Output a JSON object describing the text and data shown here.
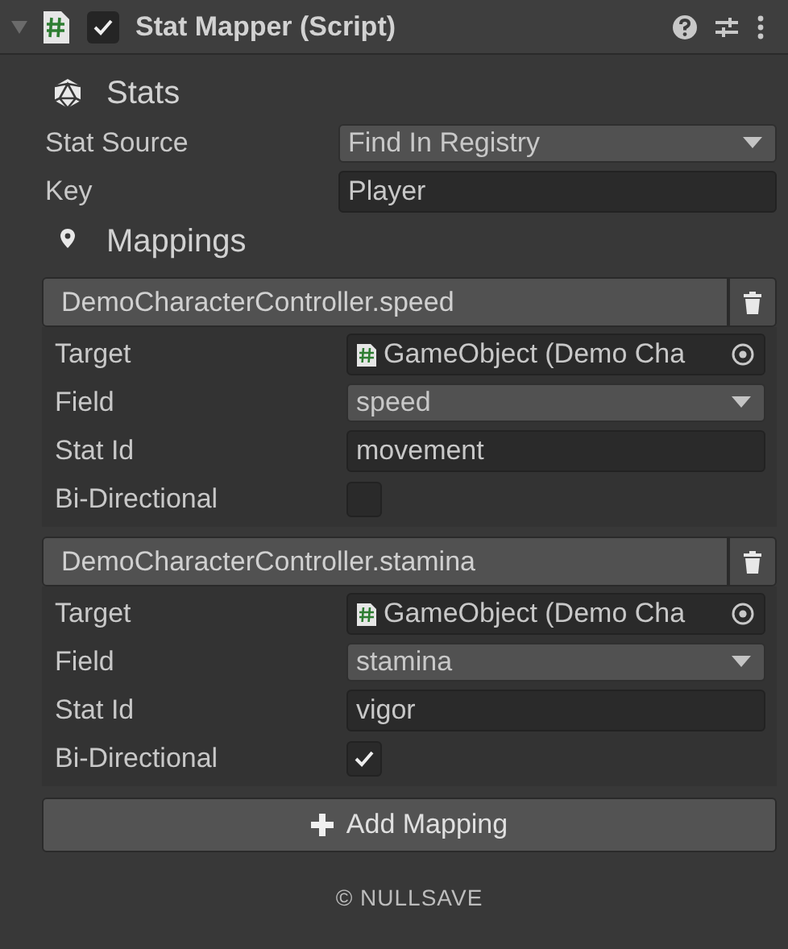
{
  "component": {
    "title": "Stat Mapper (Script)",
    "expanded": true,
    "enabled": true
  },
  "stats_section": {
    "title": "Stats",
    "stat_source": {
      "label": "Stat Source",
      "value": "Find In Registry"
    },
    "key": {
      "label": "Key",
      "value": "Player"
    }
  },
  "mappings_section": {
    "title": "Mappings"
  },
  "mappings": [
    {
      "title": "DemoCharacterController.speed",
      "target": {
        "label": "Target",
        "value": "GameObject (Demo Cha"
      },
      "field": {
        "label": "Field",
        "value": "speed"
      },
      "stat_id": {
        "label": "Stat Id",
        "value": "movement"
      },
      "bi_directional": {
        "label": "Bi-Directional",
        "checked": false
      }
    },
    {
      "title": "DemoCharacterController.stamina",
      "target": {
        "label": "Target",
        "value": "GameObject (Demo Cha"
      },
      "field": {
        "label": "Field",
        "value": "stamina"
      },
      "stat_id": {
        "label": "Stat Id",
        "value": "vigor"
      },
      "bi_directional": {
        "label": "Bi-Directional",
        "checked": true
      }
    }
  ],
  "add_button": {
    "label": "Add Mapping"
  },
  "footer": "© NULLSAVE"
}
